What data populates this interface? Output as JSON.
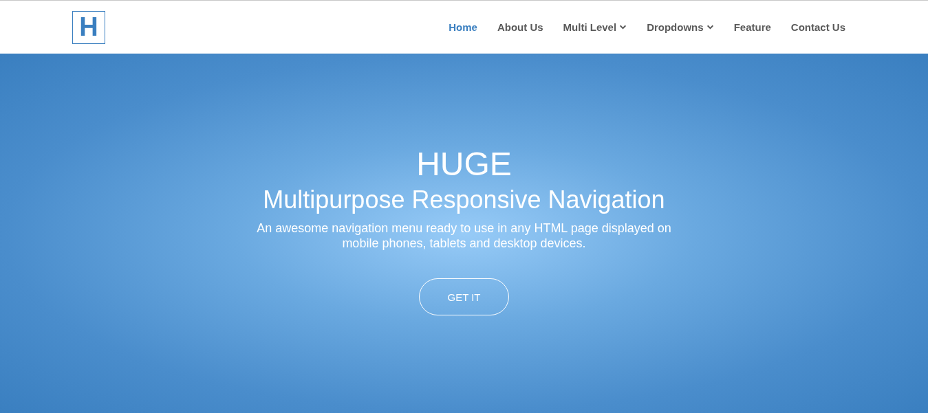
{
  "logo": {
    "letter": "H"
  },
  "nav": [
    {
      "label": "Home",
      "selected": true,
      "has_submenu": false
    },
    {
      "label": "About Us",
      "selected": false,
      "has_submenu": false
    },
    {
      "label": "Multi Level",
      "selected": false,
      "has_submenu": true
    },
    {
      "label": "Dropdowns",
      "selected": false,
      "has_submenu": true
    },
    {
      "label": "Feature",
      "selected": false,
      "has_submenu": false
    },
    {
      "label": "Contact Us",
      "selected": false,
      "has_submenu": false
    }
  ],
  "hero": {
    "title": "HUGE",
    "subtitle": "Multipurpose Responsive Navigation",
    "description": "An awesome navigation menu ready to use in any HTML page displayed on mobile phones, tablets and desktop devices.",
    "button": "GET IT"
  }
}
